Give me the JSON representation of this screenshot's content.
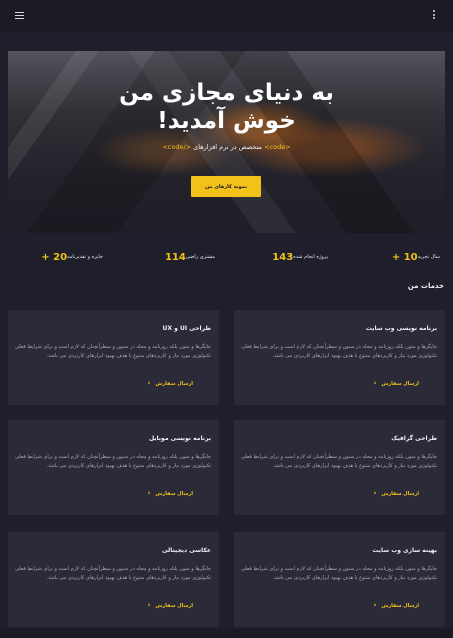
{
  "hero": {
    "title_line1": "به دنیای مجازی من",
    "title_line2": "خوش آمدید!",
    "subtitle_open": "<code>",
    "subtitle_mid": "متخصص در  نرم افزارهای",
    "subtitle_close": "</code>",
    "cta_label": "نمونه کارهای من"
  },
  "stats": [
    {
      "number": "10 +",
      "label": "سال تجربه"
    },
    {
      "number": "143",
      "label": "پروژه انجام شده"
    },
    {
      "number": "114",
      "label": "مشتری راضی"
    },
    {
      "number": "20 +",
      "label": "جایزه و تقدیرنامه"
    }
  ],
  "services": {
    "title": "خدمات من",
    "body": "چاپگرها و متون بلکه روزنامه و مجله در ستون و سطرآنچنان که لازم است و برای شرایط فعلی تکنولوژی مورد نیاز و کاربردهای متنوع با هدف بهبود ابزارهای کاربردی می باشد.",
    "link_label": "ارسال سفارش",
    "items": [
      {
        "title": "برنامه نویسی وب سایت"
      },
      {
        "title": "طراحی UI و UX"
      },
      {
        "title": "طراحی گرافیک"
      },
      {
        "title": "برنامه نویسی موبایل"
      },
      {
        "title": "بهینه سازی وب سایت"
      },
      {
        "title": "عکاسی دیجیتالی"
      }
    ]
  },
  "icons": {
    "menu": "menu-icon",
    "more": "more-vertical-icon",
    "link_arrow": "chevron-left-icon"
  },
  "colors": {
    "accent": "#f3c218",
    "background": "#1f1f2b",
    "card": "#2a2a38"
  }
}
